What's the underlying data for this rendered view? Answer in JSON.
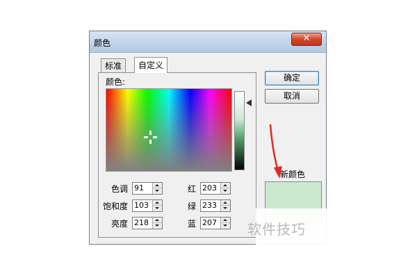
{
  "window": {
    "title": "颜色",
    "close_glyph": "✕"
  },
  "tabs": [
    {
      "label": "标准",
      "selected": false
    },
    {
      "label": "自定义",
      "selected": true
    }
  ],
  "panel": {
    "colors_label": "颜色:",
    "fields": {
      "hue": {
        "label": "色调",
        "value": "91"
      },
      "sat": {
        "label": "饱和度",
        "value": "103"
      },
      "lum": {
        "label": "亮度",
        "value": "218"
      },
      "red": {
        "label": "红",
        "value": "203"
      },
      "green": {
        "label": "绿",
        "value": "233"
      },
      "blue": {
        "label": "蓝",
        "value": "207"
      }
    }
  },
  "buttons": {
    "ok": "确定",
    "cancel": "取消"
  },
  "new_color": {
    "label": "新颜色",
    "swatch_color": "#cbe9cf"
  },
  "watermark": "软件技巧",
  "colors": {
    "annotation_arrow": "#e02a1f",
    "titlebar": "#c4d6ec"
  }
}
